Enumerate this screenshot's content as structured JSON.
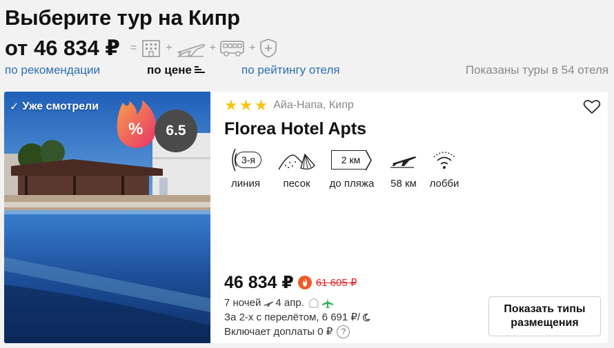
{
  "header": {
    "title": "Выберите тур на Кипр",
    "price_from": "от 46 834 ₽",
    "formula": {
      "equals": "=",
      "plus": "+",
      "icons": [
        "hotel-icon",
        "flight-icon",
        "bus-icon",
        "insurance-shield-icon"
      ]
    }
  },
  "sort": {
    "recommended": "по рекомендации",
    "by_price": "по цене",
    "by_rating": "по рейтингу отеля",
    "shown_text": "Показаны туры в 54 отеля"
  },
  "card": {
    "seen_badge": "Уже смотрели",
    "deal_badge": "%",
    "rating": "6.5",
    "stars": 3,
    "location": "Айа-Напа, Кипр",
    "hotel_name": "Florea Hotel Apts",
    "features": [
      {
        "icon": "beach-line-icon",
        "value": "3-я",
        "label": "линия"
      },
      {
        "icon": "sand-beach-icon",
        "label": "песок"
      },
      {
        "icon": "distance-icon",
        "value": "2 км",
        "label": "до пляжа"
      },
      {
        "icon": "airport-icon",
        "label": "58 км"
      },
      {
        "icon": "wifi-icon",
        "label": "лобби"
      }
    ],
    "price": "46 834 ₽",
    "price_old": "61 605 ₽",
    "nights": "7 ночей",
    "date": "4 апр.",
    "flights_text": "За 2-х с перелётом, 6 691 ₽/",
    "extra_fees": "Включает доплаты 0 ₽",
    "help": "?",
    "button_label": "Показать типы размещения",
    "colors": {
      "star": "#f5c518",
      "link": "#2a6fb0",
      "old_price": "#e0242a",
      "flight_green": "#2bb24c"
    }
  }
}
